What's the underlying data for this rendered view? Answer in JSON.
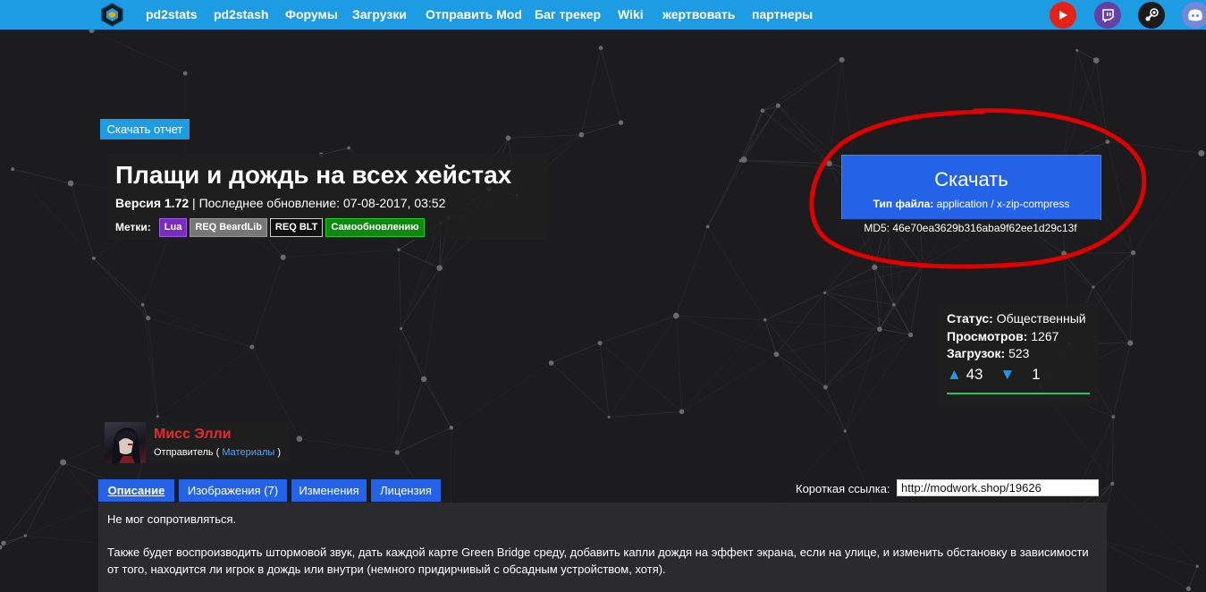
{
  "nav": {
    "items": [
      "pd2stats",
      "pd2stash",
      "Форумы",
      "Загрузки",
      "Отправить Mod",
      "Баг трекер",
      "Wiki",
      "жертвовать",
      "партнеры"
    ],
    "social": [
      "youtube-icon",
      "twitch-icon",
      "steam-icon",
      "discord-icon"
    ],
    "colors": {
      "bar": "#1d9be3",
      "youtube": "#e62117",
      "twitch": "#6441a5",
      "steam": "#1b1b1b",
      "discord": "#7289da"
    }
  },
  "report_button": "Скачать отчет",
  "mod": {
    "title": "Плащи и дождь на всех хейстах",
    "version_label": "Версия 1.72",
    "separator": " | ",
    "updated_label": "Последнее обновление: 07-08-2017, 03:52",
    "tags_label": "Метки:",
    "tags": [
      "Lua",
      "REQ BeardLib",
      "REQ BLT",
      "Самообновлению"
    ]
  },
  "download": {
    "label": "Скачать",
    "filetype_label": "Тип файла:",
    "filetype_value": " application / x-zip-compress",
    "md5": "MD5: 46e70ea3629b316aba9f62ee1d29c13f",
    "accent": "#2463e8"
  },
  "stats": {
    "status_label": "Статус:",
    "status_value": " Общественный",
    "views_label": "Просмотров:",
    "views_value": " 1267",
    "downloads_label": "Загрузок:",
    "downloads_value": " 523",
    "upvotes": "43",
    "downvotes": "1"
  },
  "author": {
    "name": "Мисс Элли",
    "role_prefix": "Отправитель ( ",
    "role_link": "Материалы",
    "role_suffix": " )"
  },
  "tabs": [
    "Описание",
    "Изображения (7)",
    "Изменения",
    "Лицензия"
  ],
  "shortlink": {
    "label": "Короткая ссылка:",
    "value": "http://modwork.shop/19626"
  },
  "description": {
    "line1": "Не мог сопротивляться.",
    "line2": "Также будет воспроизводить штормовой звук, дать каждой карте Green Bridge среду, добавить капли дождя на эффект экрана, если на улице, и изменить обстановку в зависимости от того, находится ли игрок в дождь или внутри (немного придирчивый с обсадным устройством, хотя)."
  }
}
